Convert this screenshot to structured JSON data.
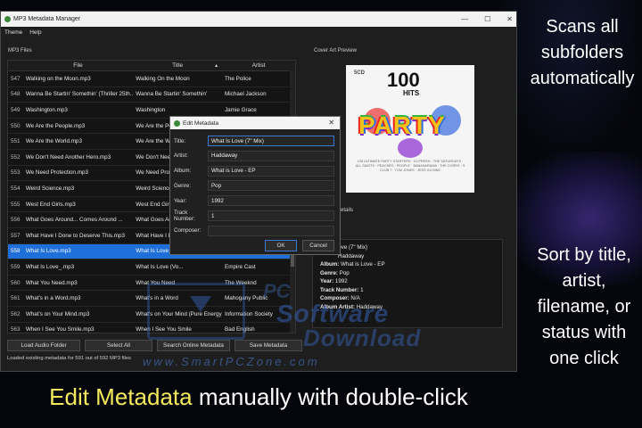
{
  "window": {
    "title": "MP3 Metadata Manager",
    "controls": [
      "—",
      "☐",
      "✕"
    ]
  },
  "menu": [
    "Theme",
    "Help"
  ],
  "panels": {
    "files_label": "MP3 Files",
    "cover_label": "Cover Art Preview",
    "details_label": "etails"
  },
  "columns": {
    "file": "File",
    "title": "Title",
    "artist": "Artist",
    "sort_indicator": "▲"
  },
  "rows": [
    {
      "num": "547",
      "file": "Walking on the Moon.mp3",
      "title": "Walking On the Moon",
      "artist": "The Police"
    },
    {
      "num": "548",
      "file": "Wanna Be Startin' Somethin' (Thriller 25th...",
      "title": "Wanna Be Startin' Somethin'",
      "artist": "Michael Jackson"
    },
    {
      "num": "549",
      "file": "Washington.mp3",
      "title": "Washington",
      "artist": "Jamie Grace"
    },
    {
      "num": "550",
      "file": "We Are the People.mp3",
      "title": "We Are the Pe",
      "artist": ""
    },
    {
      "num": "551",
      "file": "We Are the World.mp3",
      "title": "We Are the W",
      "artist": ""
    },
    {
      "num": "552",
      "file": "We Don't Need Another Hero.mp3",
      "title": "We Don't Nee",
      "artist": ""
    },
    {
      "num": "553",
      "file": "We Need Protection.mp3",
      "title": "We Need Prote",
      "artist": ""
    },
    {
      "num": "554",
      "file": "Weird Science.mp3",
      "title": "Weird Science",
      "artist": ""
    },
    {
      "num": "555",
      "file": "West End Girls.mp3",
      "title": "West End Girls",
      "artist": ""
    },
    {
      "num": "556",
      "file": "What Goes Around... Comes Around ...",
      "title": "What Goes Ar",
      "artist": ""
    },
    {
      "num": "557",
      "file": "What Have I Done to Deserve This.mp3",
      "title": "What Have I D",
      "artist": ""
    },
    {
      "num": "558",
      "file": "What Is Love.mp3",
      "title": "What Is Love (7",
      "artist": ""
    },
    {
      "num": "559",
      "file": "What Is Love_.mp3",
      "title": "What Is Love (Vo...",
      "artist": "Empire Cast"
    },
    {
      "num": "560",
      "file": "What You Need.mp3",
      "title": "What You Need",
      "artist": "The Weeknd"
    },
    {
      "num": "561",
      "file": "What's in a Word.mp3",
      "title": "What's in a Word",
      "artist": "Mahogany Public"
    },
    {
      "num": "562",
      "file": "What's on Your Mind.mp3",
      "title": "What's on Your Mind (Pure Energy)",
      "artist": "Information Society"
    },
    {
      "num": "563",
      "file": "When I See You Smile.mp3",
      "title": "When I See You Smile",
      "artist": "Bad English"
    }
  ],
  "selected_row": "558",
  "cover": {
    "cd": "5CD",
    "big": "100",
    "hits": "HITS",
    "party": "PARTY",
    "sub": "135 ULTIMATE PARTY STARTERS · DJ FRESH · THE SATURDAYS · ALL SAINTS · PEACHES · PEOPLE · BANANARAMA · THE CORRS · S CLUB 7 · TOM JONES · JESS GLYNNE"
  },
  "details": {
    "title": "nat Is Love (7\" Mix)",
    "artist": "Haddaway",
    "album_label": "Album:",
    "album": "What is Love - EP",
    "genre_label": "Genre:",
    "genre": "Pop",
    "year_label": "Year:",
    "year": "1992",
    "track_label": "Track Number:",
    "track": "1",
    "composer_label": "Composer:",
    "composer": "N/A",
    "album_artist_label": "Album Artist:",
    "album_artist": "Haddaway"
  },
  "buttons": {
    "load": "Load Audio Folder",
    "select_all": "Select All",
    "search": "Search Online Metadata",
    "save": "Save Metadata"
  },
  "status": "Loaded existing metadata for 591 out of 592 MP3 files",
  "dialog": {
    "title": "Edit Metadata",
    "close": "✕",
    "fields": [
      {
        "label": "Title:",
        "value": "What Is Love (7\" Mix)"
      },
      {
        "label": "Artist:",
        "value": "Haddaway"
      },
      {
        "label": "Album:",
        "value": "What is Love - EP"
      },
      {
        "label": "Genre:",
        "value": "Pop"
      },
      {
        "label": "Year:",
        "value": "1992"
      },
      {
        "label": "Track Number:",
        "value": "1"
      },
      {
        "label": "Composer:",
        "value": ""
      }
    ],
    "ok": "OK",
    "cancel": "Cancel"
  },
  "watermark": {
    "line1": "PC",
    "line2": "Software",
    "line3": "Download",
    "site": "www.SmartPCZone.com"
  },
  "side_text": {
    "top": [
      "Scans all",
      "subfolders",
      "automatically"
    ],
    "bottom": [
      "Sort by title,",
      "artist,",
      "filename, or",
      "status with",
      "one click"
    ]
  },
  "caption": {
    "highlight": "Edit Metadata",
    "rest": " manually with double-click"
  }
}
